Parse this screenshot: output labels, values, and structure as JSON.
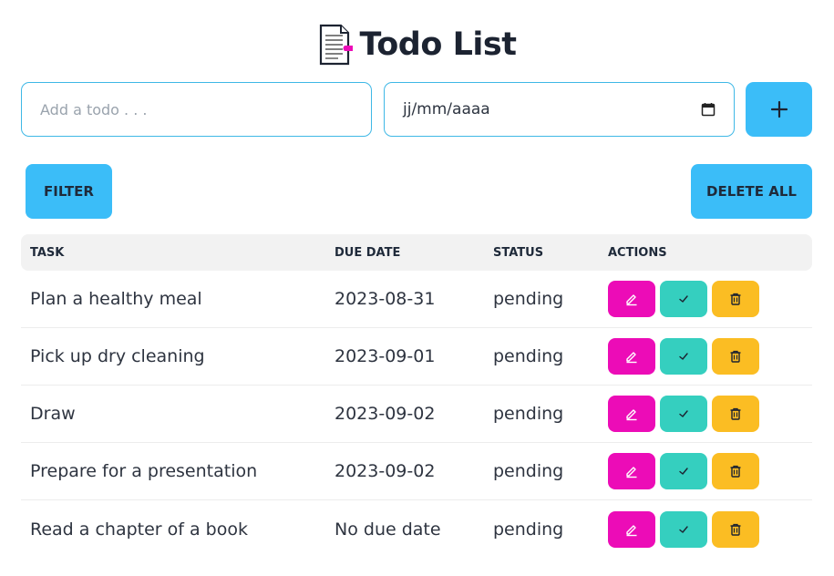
{
  "app": {
    "title": "Todo List",
    "logo_icon": "document-icon"
  },
  "form": {
    "todo_placeholder": "Add a todo . . .",
    "date_placeholder": "jj/mm/aaaa",
    "add_icon": "plus-icon"
  },
  "toolbar": {
    "filter_label": "FILTER",
    "delete_all_label": "DELETE ALL"
  },
  "table": {
    "headers": {
      "task": "TASK",
      "due_date": "DUE DATE",
      "status": "STATUS",
      "actions": "ACTIONS"
    },
    "rows": [
      {
        "task": "Plan a healthy meal",
        "due_date": "2023-08-31",
        "status": "pending"
      },
      {
        "task": "Pick up dry cleaning",
        "due_date": "2023-09-01",
        "status": "pending"
      },
      {
        "task": "Draw",
        "due_date": "2023-09-02",
        "status": "pending"
      },
      {
        "task": "Prepare for a presentation",
        "due_date": "2023-09-02",
        "status": "pending"
      },
      {
        "task": "Read a chapter of a book",
        "due_date": "No due date",
        "status": "pending"
      }
    ]
  },
  "colors": {
    "accent": "#3bbdf8",
    "edit": "#ec0cb7",
    "complete": "#35cfbf",
    "delete": "#fbbd23"
  }
}
